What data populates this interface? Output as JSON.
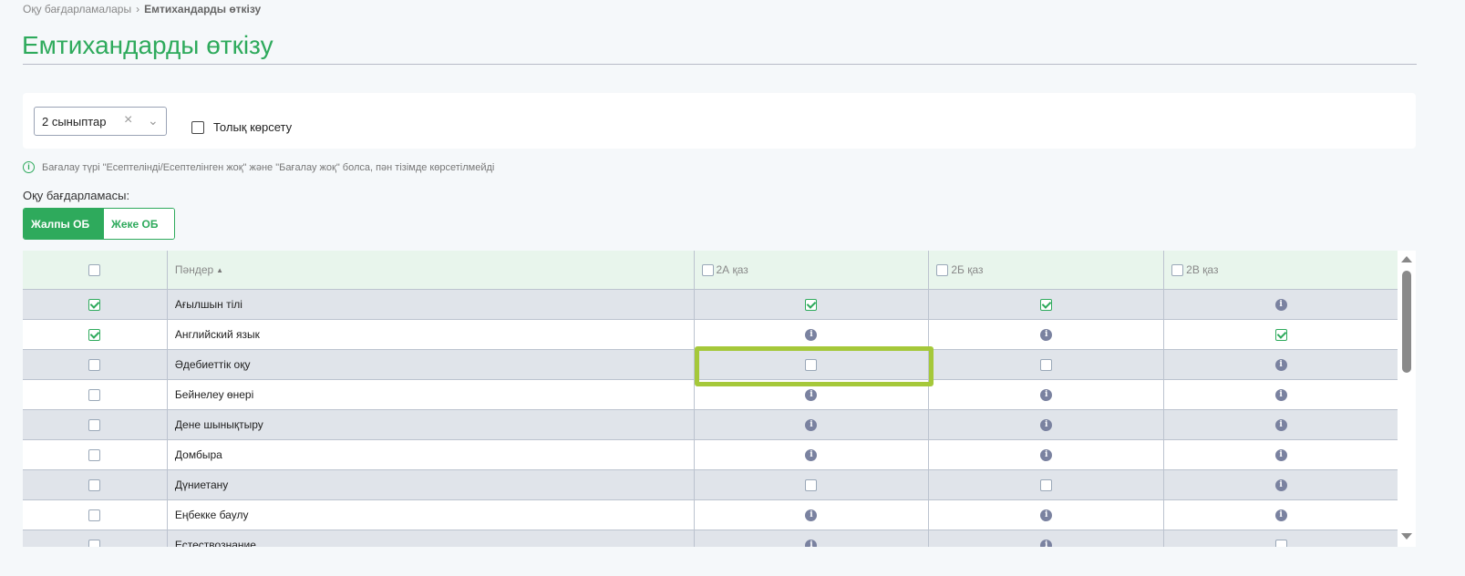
{
  "breadcrumb": {
    "parent": "Оқу бағдарламалары",
    "current": "Емтихандарды өткізу"
  },
  "page_title": "Емтихандарды өткізу",
  "filter": {
    "class_select": "2 сыныптар",
    "clear_icon": "×",
    "full_show_label": "Толық көрсету",
    "full_show_checked": false
  },
  "note": "Бағалау түрі \"Есептелінді/Есептелінген жоқ\" және \"Бағалау жоқ\" болса, пән тізімде көрсетілмейді",
  "program": {
    "label": "Оқу бағдарламасы:",
    "tabs": [
      {
        "label": "Жалпы ОБ",
        "active": true
      },
      {
        "label": "Жеке ОБ",
        "active": false
      }
    ]
  },
  "table": {
    "subject_header": "Пәндер",
    "class_headers": [
      "2А қаз",
      "2Б қаз",
      "2В қаз"
    ],
    "rows": [
      {
        "subject": "Ағылшын тілі",
        "selected": true,
        "cells": [
          "checked",
          "checked",
          "info"
        ]
      },
      {
        "subject": "Английский язык",
        "selected": true,
        "cells": [
          "info",
          "info",
          "checked"
        ]
      },
      {
        "subject": "Әдебиеттік оқу",
        "selected": false,
        "cells": [
          "unchecked",
          "unchecked",
          "info"
        ]
      },
      {
        "subject": "Бейнелеу өнері",
        "selected": false,
        "cells": [
          "info",
          "info",
          "info"
        ]
      },
      {
        "subject": "Дене шынықтыру",
        "selected": false,
        "cells": [
          "info",
          "info",
          "info"
        ]
      },
      {
        "subject": "Домбыра",
        "selected": false,
        "cells": [
          "info",
          "info",
          "info"
        ]
      },
      {
        "subject": "Дүниетану",
        "selected": false,
        "cells": [
          "unchecked",
          "unchecked",
          "info"
        ]
      },
      {
        "subject": "Еңбекке баулу",
        "selected": false,
        "cells": [
          "info",
          "info",
          "info"
        ]
      },
      {
        "subject": "Естествознание",
        "selected": false,
        "cells": [
          "info",
          "info",
          "unchecked"
        ]
      }
    ]
  },
  "colors": {
    "accent": "#2eaa5c",
    "highlight": "#a5c83a",
    "info_icon": "#7a82a0"
  }
}
